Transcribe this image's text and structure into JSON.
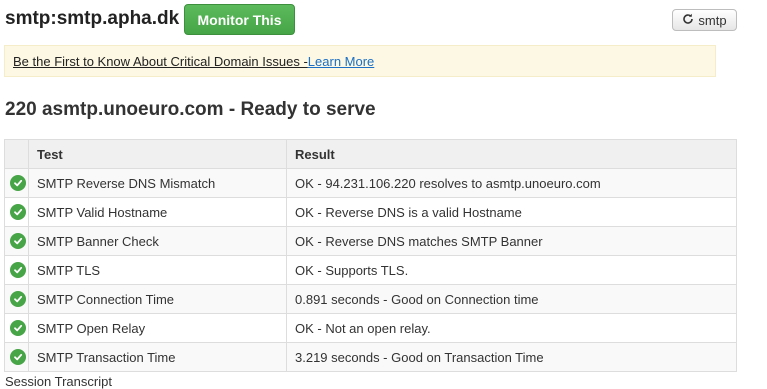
{
  "header": {
    "title": "smtp:smtp.apha.dk",
    "monitor_label": "Monitor This",
    "refresh_label": "smtp"
  },
  "banner": {
    "text": "Be the First to Know About Critical Domain Issues - ",
    "link": "Learn More"
  },
  "result_heading": "220 asmtp.unoeuro.com - Ready to serve",
  "table": {
    "headers": [
      "",
      "Test",
      "Result"
    ],
    "rows": [
      {
        "test": "SMTP Reverse DNS Mismatch",
        "result": "OK - 94.231.106.220 resolves to asmtp.unoeuro.com",
        "status": "ok"
      },
      {
        "test": "SMTP Valid Hostname",
        "result": "OK - Reverse DNS is a valid Hostname",
        "status": "ok"
      },
      {
        "test": "SMTP Banner Check",
        "result": "OK - Reverse DNS matches SMTP Banner",
        "status": "ok"
      },
      {
        "test": "SMTP TLS",
        "result": "OK - Supports TLS.",
        "status": "ok"
      },
      {
        "test": "SMTP Connection Time",
        "result": "0.891 seconds - Good on Connection time",
        "status": "ok"
      },
      {
        "test": "SMTP Open Relay",
        "result": "OK - Not an open relay.",
        "status": "ok"
      },
      {
        "test": "SMTP Transaction Time",
        "result": "3.219 seconds - Good on Transaction Time",
        "status": "ok"
      }
    ]
  },
  "footer_text": "Session Transcript",
  "colors": {
    "ok_green": "#47a447",
    "monitor_green": "#46a546",
    "banner_bg": "#fcf8e3",
    "link_blue": "#1b6fc4"
  },
  "icons": {
    "status": "check-circle-icon",
    "refresh": "refresh-icon"
  }
}
